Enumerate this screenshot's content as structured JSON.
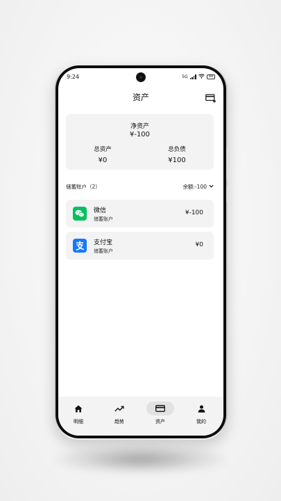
{
  "status_bar": {
    "time": "9:24",
    "network": "5G",
    "battery": "99"
  },
  "header": {
    "title": "资产",
    "card_icon": "add-card-icon"
  },
  "summary": {
    "net_assets_label": "净资产",
    "net_assets_value": "¥-100",
    "total_assets_label": "总资产",
    "total_assets_value": "¥0",
    "total_liabilities_label": "总负债",
    "total_liabilities_value": "¥100"
  },
  "section": {
    "title": "储蓄账户（2）",
    "balance": "余额:-100"
  },
  "accounts": [
    {
      "name": "微信",
      "type": "储蓄账户",
      "amount": "¥-100",
      "icon": "wechat-icon",
      "color": "#07c160"
    },
    {
      "name": "支付宝",
      "type": "储蓄账户",
      "amount": "¥0",
      "icon": "alipay-icon",
      "color": "#1677ff"
    }
  ],
  "tabs": [
    {
      "label": "明细",
      "icon": "home-icon",
      "active": false
    },
    {
      "label": "趋势",
      "icon": "trending-up-icon",
      "active": false
    },
    {
      "label": "资产",
      "icon": "credit-card-icon",
      "active": true
    },
    {
      "label": "我的",
      "icon": "person-icon",
      "active": false
    }
  ]
}
